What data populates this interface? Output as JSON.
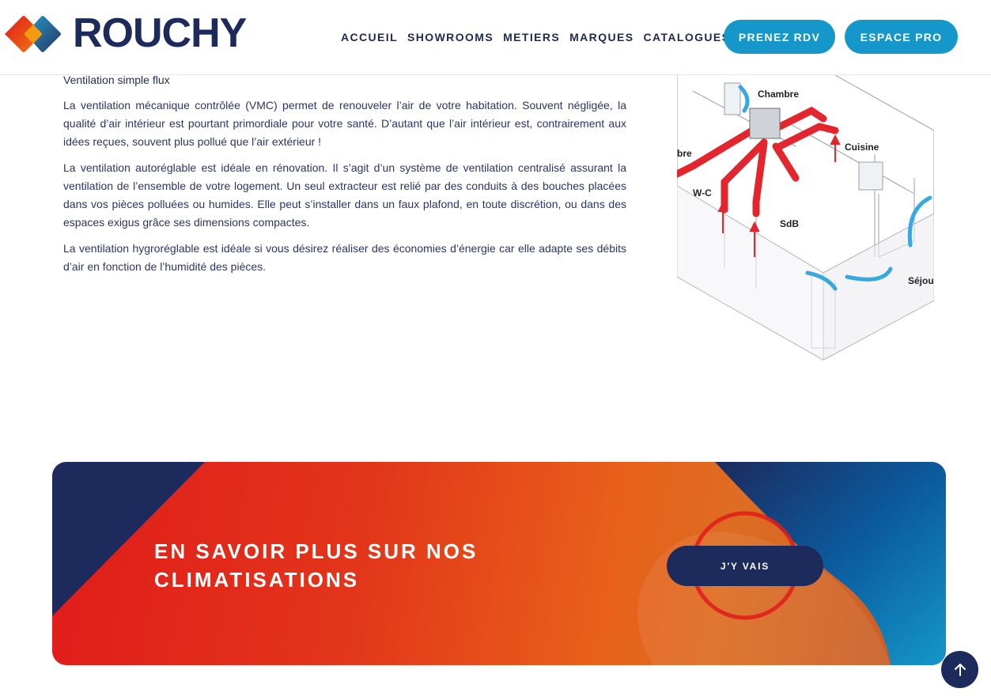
{
  "brand": {
    "name": "ROUCHY",
    "colors": {
      "navy": "#1d2a5c",
      "red": "#e01b1b",
      "orange": "#e8601a",
      "blue": "#1597c9"
    }
  },
  "nav": {
    "items": [
      "ACCUEIL",
      "SHOWROOMS",
      "METIERS",
      "MARQUES",
      "CATALOGUES"
    ],
    "rdv_label": "PRENEZ RDV",
    "pro_label": "ESPACE PRO"
  },
  "content": {
    "subtitle": "Ventilation simple flux",
    "paragraphs": [
      "La ventilation mécanique contrôlée (VMC) permet de renouveler l’air de votre habitation. Souvent négligée, la qualité d’air intérieur est pourtant primordiale pour votre santé. D’autant que l’air intérieur est, contrairement aux idées reçues, souvent plus pollué que l’air extérieur !",
      "La ventilation autoréglable est idéale en rénovation. Il s’agit d’un système de ventilation centralisé assurant la ventilation de l’ensemble de votre logement. Un seul extracteur est relié par des conduits à des bouches placées dans vos pièces polluées ou humides. Elle peut s’installer dans un faux plafond, en toute discrétion, ou dans des espaces exigus grâce ses dimensions compactes.",
      "La ventilation hygroréglable est idéale si vous désirez réaliser des économies d’énergie car elle adapte ses débits d’air en fonction de l’humidité des pièces."
    ]
  },
  "diagram": {
    "labels": {
      "chambre": "Chambre",
      "cuisine": "Cuisine",
      "wc": "W-C",
      "sdb": "SdB",
      "sejour": "Séjou",
      "partial": "bre"
    }
  },
  "banner": {
    "title": "EN SAVOIR PLUS SUR NOS CLIMATISATIONS",
    "button_label": "J'Y VAIS"
  },
  "scroll_top": {
    "icon": "arrow-up-icon"
  }
}
